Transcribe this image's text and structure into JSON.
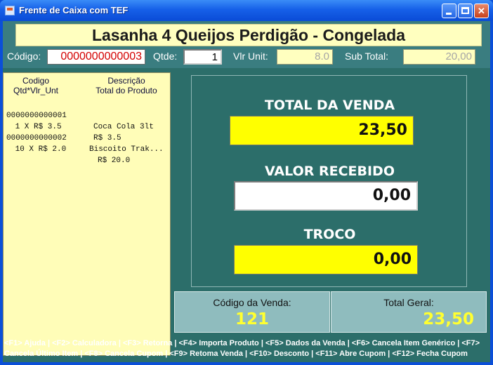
{
  "window": {
    "title": "Frente de Caixa com TEF"
  },
  "header": {
    "product_name": "Lasanha 4 Queijos Perdigão - Congelada",
    "codigo_label": "Código:",
    "codigo_value": "0000000000003",
    "qtde_label": "Qtde:",
    "qtde_value": "1",
    "vlr_unit_label": "Vlr Unit:",
    "vlr_unit_value": "8.0",
    "sub_total_label": "Sub Total:",
    "sub_total_value": "20,00"
  },
  "item_list": {
    "header_col1_line1": "Codigo",
    "header_col1_line2": "Qtd*Vlr_Unt",
    "header_col2_line1": "Descrição",
    "header_col2_line2": "Total do Produto",
    "rows": [
      {
        "code": "0000000000001",
        "desc": "Coca Cola 3lt"
      },
      {
        "code": " 1 X R$ 3.5",
        "desc": "R$ 3.5"
      },
      {
        "code": "0000000000002",
        "desc": "Biscoito Trak..."
      },
      {
        "code": " 10 X R$ 2.0",
        "desc": "R$ 20.0"
      }
    ]
  },
  "totals": {
    "total_label": "TOTAL DA VENDA",
    "total_value": "23,50",
    "recebido_label": "VALOR RECEBIDO",
    "recebido_value": "0,00",
    "troco_label": "TROCO",
    "troco_value": "0,00"
  },
  "footer": {
    "codigo_venda_label": "Código da Venda:",
    "codigo_venda_value": "121",
    "total_geral_label": "Total Geral:",
    "total_geral_value": "23,50"
  },
  "shortcuts": {
    "line1": "<F1> Ajuda | <F2> Calculadora | <F3> Retorna | <F4> Importa Produto | <F5> Dados da Venda | <F6> Cancela Item Genérico | <F7>",
    "line2": "Cancela Último Item | <F8> Cancela Cupom | <F9> Retoma Venda | <F10> Desconto | <F11> Abre Cupom | <F12> Fecha Cupom"
  },
  "colors": {
    "title_bar": "#0a4bd6",
    "background": "#2c6e6a",
    "field_yellow": "#ffff00",
    "panel_cream": "#fffdb8",
    "total_geral_text": "#ffff30"
  }
}
